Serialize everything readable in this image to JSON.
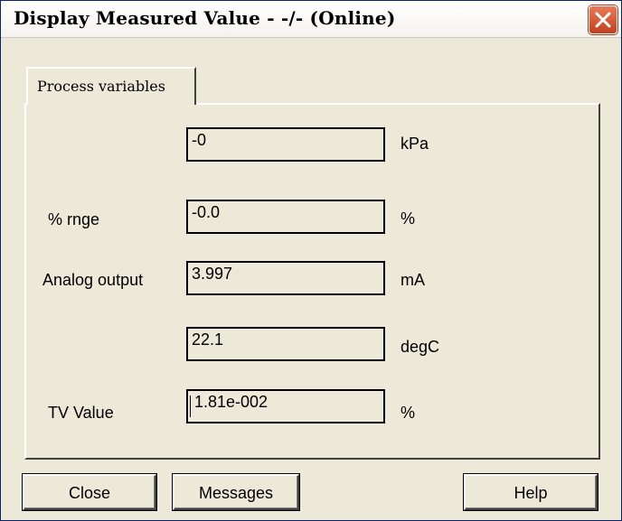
{
  "window": {
    "title": "Display Measured Value - -/-  (Online)",
    "close_icon": "close-icon"
  },
  "tabs": [
    {
      "label": "Process variables",
      "selected": true
    }
  ],
  "rows": [
    {
      "label": "",
      "value": "-0",
      "unit": "kPa"
    },
    {
      "label": "% rnge",
      "value": "-0.0",
      "unit": "%"
    },
    {
      "label": "Analog output",
      "value": "3.997",
      "unit": "mA"
    },
    {
      "label": "",
      "value": "22.1",
      "unit": "degC"
    },
    {
      "label": "TV Value",
      "value": "1.81e-002",
      "unit": "%"
    }
  ],
  "buttons": {
    "close": "Close",
    "messages": "Messages",
    "help": "Help"
  }
}
